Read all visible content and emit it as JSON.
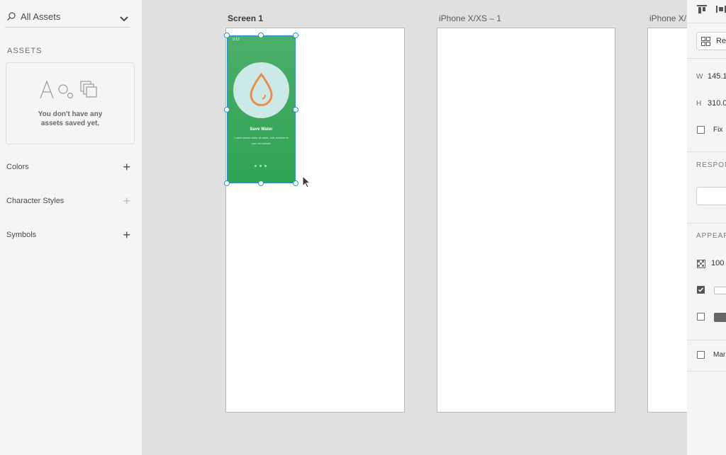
{
  "assets_panel": {
    "search_value": "All Assets",
    "section_title": "ASSETS",
    "empty_message": "You don't have any\nassets saved yet.",
    "sections": [
      {
        "label": "Colors"
      },
      {
        "label": "Character Styles"
      },
      {
        "label": "Symbols"
      }
    ]
  },
  "canvas": {
    "artboards": [
      {
        "title": "Screen 1"
      },
      {
        "title": "iPhone X/XS – 1"
      },
      {
        "title": "iPhone X/"
      }
    ],
    "mobile_screen": {
      "status_time": "9:12",
      "title": "Save Water",
      "subtitle": "Lorem ipsum dolor sit amet, iulis modern te quo, vel dolctor.",
      "page_dots": 3,
      "active_dot": 0,
      "colors": {
        "gradient_top": "#4cae6a",
        "gradient_bottom": "#2fa353",
        "circle": "#cbe9e6",
        "drop": "#ef8a4a"
      }
    },
    "selection_color": "#2b8fd6"
  },
  "property_panel": {
    "repeat_label": "Rep",
    "w_label": "W",
    "w_value": "145.1",
    "h_label": "H",
    "h_value": "310.0",
    "fix_label": "Fix",
    "responsive_label": "RESPON",
    "appearance_label": "APPEAR",
    "opacity_value": "100",
    "mask_label": "Mar"
  }
}
